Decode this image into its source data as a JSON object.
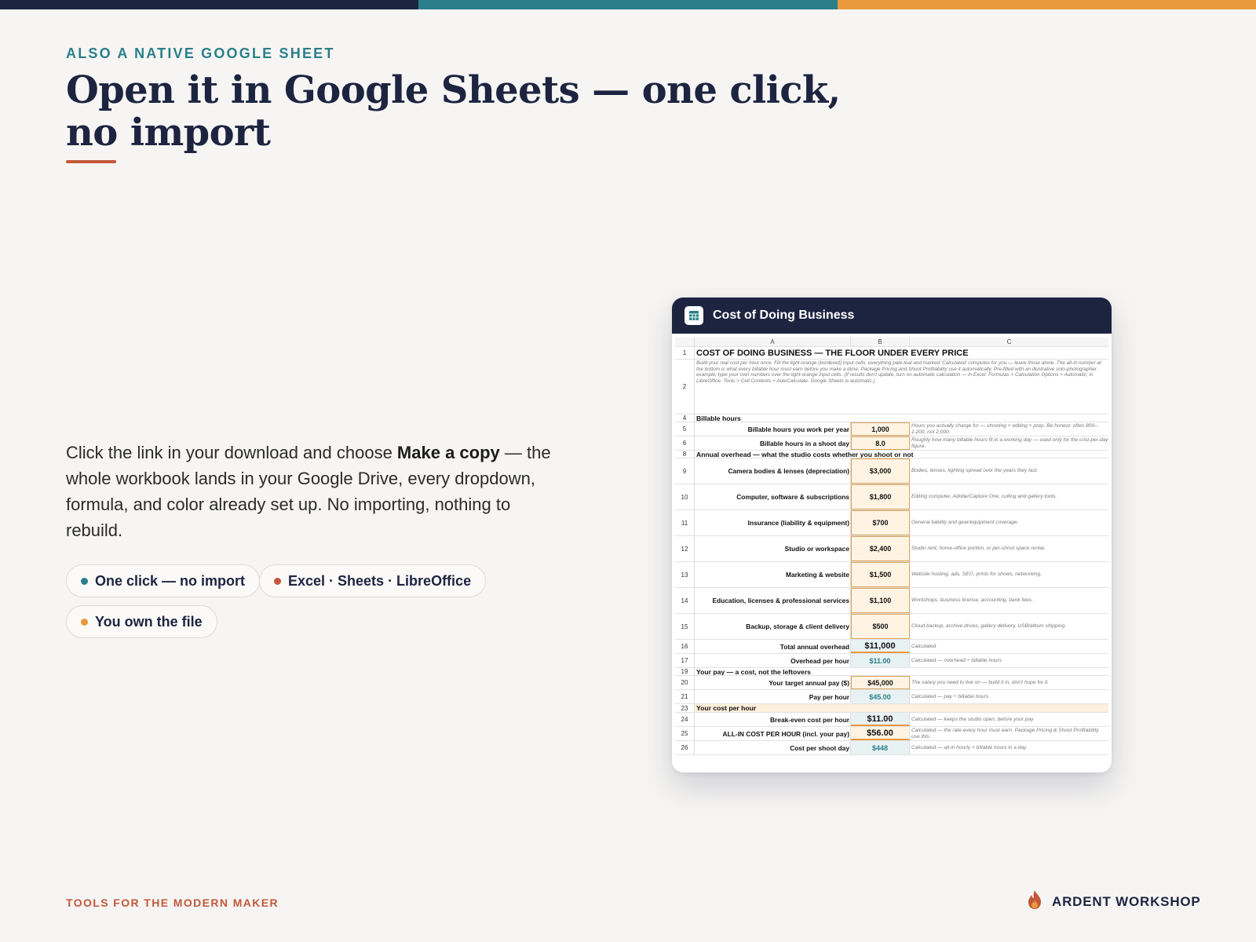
{
  "colors": {
    "navy": "#1c2440",
    "teal": "#2a7f8a",
    "orange": "#e89a3c",
    "rust": "#c2583a",
    "background": "#f6f5f3",
    "input_fill": "#fff4e3",
    "calc_fill": "#e9f2f3"
  },
  "topbar": [
    "#1c2440",
    "#2a7f8a",
    "#e89a3c"
  ],
  "header": {
    "eyebrow": "ALSO A NATIVE GOOGLE SHEET",
    "headline": "Open it in Google Sheets — one click, no import"
  },
  "body": {
    "part1": "Click the link in your download and choose ",
    "emphasis": "Make a copy",
    "part2": " — the whole workbook lands in your Google Drive, every dropdown, formula, and color already set up. No importing, nothing to rebuild."
  },
  "pills": [
    {
      "label": "One click — no import",
      "dot_color": "#2a7f8a"
    },
    {
      "label": "Excel · Sheets · LibreOffice",
      "dot_color": "#c2583a"
    },
    {
      "label": "You own the file",
      "dot_color": "#e89a3c"
    }
  ],
  "card": {
    "title": "Cost of Doing Business",
    "icon": "spreadsheet-icon"
  },
  "sheet": {
    "columns": [
      "A",
      "B",
      "C"
    ],
    "rows": [
      {
        "n": "1",
        "type": "title",
        "a": "COST OF DOING BUSINESS — THE FLOOR UNDER EVERY PRICE"
      },
      {
        "n": "2",
        "type": "intro",
        "a": "Build your real cost per hour once. Fill the light-orange (bordered) input cells; everything pale-teal and marked 'Calculated' computes for you — leave those alone. The all-in number at the bottom is what every billable hour must earn before you make a dime; Package Pricing and Shoot Profitability use it automatically. Pre-filled with an illustrative solo-photographer example; type your own numbers over the light-orange input cells. (If results don't update, turn on automatic calculation — in Excel: Formulas > Calculation Options > Automatic; in LibreOffice: Tools > Cell Contents > AutoCalculate. Google Sheets is automatic.)"
      },
      {
        "n": "4",
        "type": "section",
        "a": "Billable hours"
      },
      {
        "n": "5",
        "type": "input",
        "a": "Billable hours you work per year",
        "b": "1,000",
        "c": "Hours you actually charge for — shooting + editing + prep. Be honest: often 800–1,200, not 2,000."
      },
      {
        "n": "6",
        "type": "input",
        "a": "Billable hours in a shoot day",
        "b": "8.0",
        "c": "Roughly how many billable hours fit in a working day — used only for the cost-per-day figure."
      },
      {
        "n": "8",
        "type": "section",
        "a": "Annual overhead — what the studio costs whether you shoot or not"
      },
      {
        "n": "9",
        "type": "input-tall",
        "a": "Camera bodies & lenses (depreciation)",
        "b": "$3,000",
        "c": "Bodies, lenses, lighting spread over the years they last."
      },
      {
        "n": "10",
        "type": "input-tall",
        "a": "Computer, software & subscriptions",
        "b": "$1,800",
        "c": "Editing computer, Adobe/Capture One, culling and gallery tools."
      },
      {
        "n": "11",
        "type": "input-tall",
        "a": "Insurance (liability & equipment)",
        "b": "$700",
        "c": "General liability and gear/equipment coverage."
      },
      {
        "n": "12",
        "type": "input-tall",
        "a": "Studio or workspace",
        "b": "$2,400",
        "c": "Studio rent, home-office portion, or per-shoot space rental."
      },
      {
        "n": "13",
        "type": "input-tall",
        "a": "Marketing & website",
        "b": "$1,500",
        "c": "Website hosting, ads, SEO, prints for shows, networking."
      },
      {
        "n": "14",
        "type": "input-tall",
        "a": "Education, licenses & professional services",
        "b": "$1,100",
        "c": "Workshops, business license, accounting, bank fees."
      },
      {
        "n": "15",
        "type": "input-tall",
        "a": "Backup, storage & client delivery",
        "b": "$500",
        "c": "Cloud backup, archive drives, gallery delivery, USB/album shipping."
      },
      {
        "n": "16",
        "type": "calc-big",
        "a": "Total annual overhead",
        "b": "$11,000",
        "c": "Calculated"
      },
      {
        "n": "17",
        "type": "calc",
        "a": "Overhead per hour",
        "b": "$11.00",
        "c": "Calculated — overhead ÷ billable hours"
      },
      {
        "n": "19",
        "type": "section",
        "a": "Your pay — a cost, not the leftovers"
      },
      {
        "n": "20",
        "type": "input",
        "a": "Your target annual pay ($)",
        "b": "$45,000",
        "c": "The salary you need to live on — build it in, don't hope for it."
      },
      {
        "n": "21",
        "type": "calc",
        "a": "Pay per hour",
        "b": "$45.00",
        "c": "Calculated — pay ÷ billable hours"
      },
      {
        "n": "23",
        "type": "section-highlight",
        "a": "Your cost per hour"
      },
      {
        "n": "24",
        "type": "calc-big",
        "a": "Break-even cost per hour",
        "b": "$11.00",
        "c": "Calculated — keeps the studio open, before your pay"
      },
      {
        "n": "25",
        "type": "calc-big-orange",
        "a": "ALL-IN COST PER HOUR (incl. your pay)",
        "b": "$56.00",
        "c": "Calculated — the rate every hour must earn. Package Pricing & Shoot Profitability use this."
      },
      {
        "n": "26",
        "type": "calc",
        "a": "Cost per shoot day",
        "b": "$448",
        "c": "Calculated — all-in hourly × billable hours in a day"
      }
    ]
  },
  "footer": {
    "tagline": "TOOLS FOR THE MODERN MAKER",
    "brand": "ARDENT WORKSHOP",
    "brand_icon": "flame-icon"
  }
}
